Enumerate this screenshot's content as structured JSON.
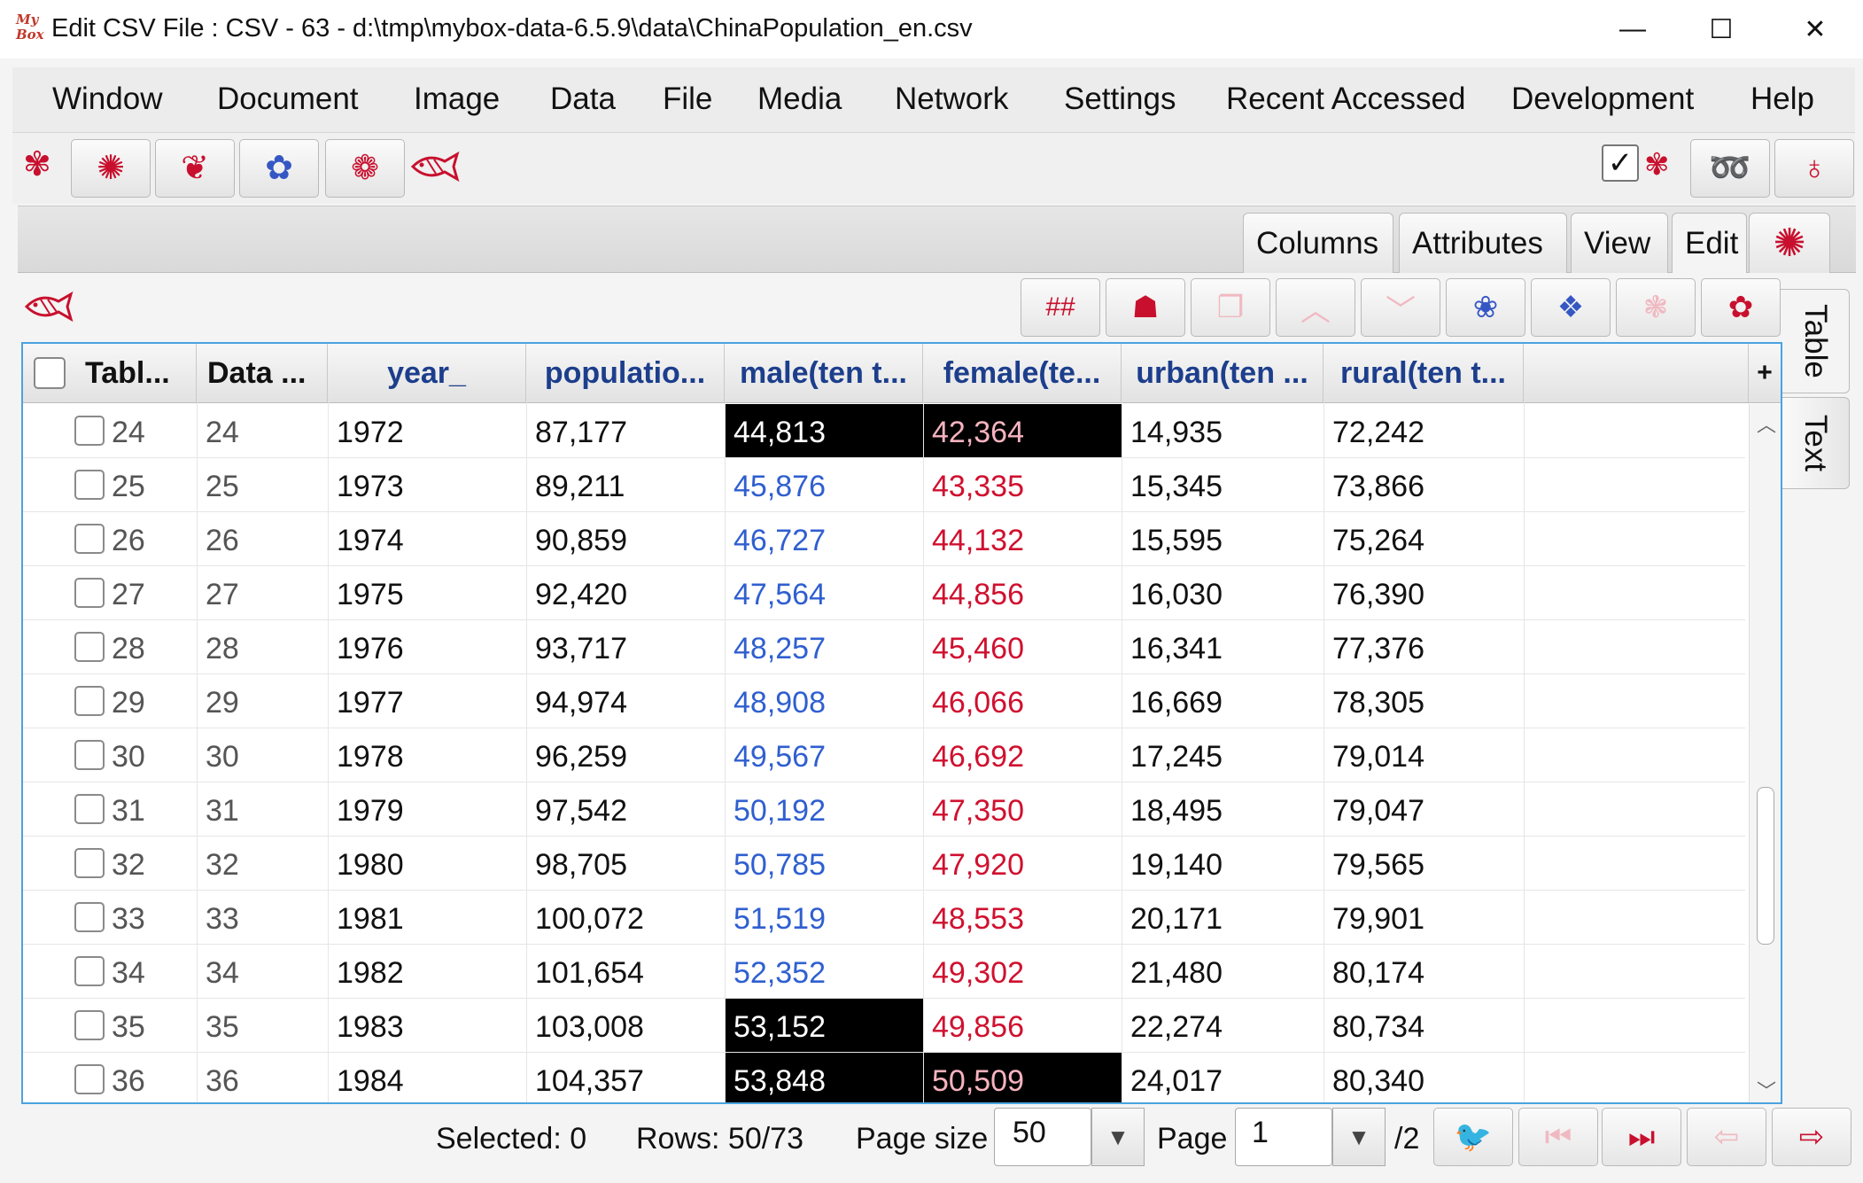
{
  "window": {
    "logo_text": "My Box",
    "title": "Edit CSV File : CSV - 63 - d:\\tmp\\mybox-data-6.5.9\\data\\ChinaPopulation_en.csv",
    "minimize": "—",
    "maximize": "☐",
    "close": "✕"
  },
  "menu": [
    "Window",
    "Document",
    "Image",
    "Data",
    "File",
    "Media",
    "Network",
    "Settings",
    "Recent Accessed",
    "Development",
    "Help"
  ],
  "toolbar": {
    "icons": [
      "rooster-icon",
      "swirl-icon",
      "lotus-icon",
      "flower-icon",
      "peony-icon",
      "fish-icon"
    ],
    "glyphs": [
      "✾",
      "✺",
      "❦",
      "✿",
      "❁",
      "✺"
    ],
    "checkbox_checked": true,
    "right_icons": [
      "rooster-icon",
      "cloud-swirl-icon",
      "gourd-icon"
    ]
  },
  "tabs": [
    "Columns",
    "Attributes",
    "View",
    "Edit"
  ],
  "side_tabs": [
    "Table",
    "Text"
  ],
  "edit_toolbar": {
    "hash_label": "##"
  },
  "table": {
    "columns": [
      "Tabl...",
      "Data ...",
      "year_",
      "populatio...",
      "male(ten t...",
      "female(te...",
      "urban(ten ...",
      "rural(ten t..."
    ],
    "add_column": "+",
    "rows": [
      {
        "t": "24",
        "d": "24",
        "year": "1972",
        "pop": "87,177",
        "male": "44,813",
        "female": "42,364",
        "urban": "14,935",
        "rural": "72,242",
        "male_sel": true,
        "female_sel": true
      },
      {
        "t": "25",
        "d": "25",
        "year": "1973",
        "pop": "89,211",
        "male": "45,876",
        "female": "43,335",
        "urban": "15,345",
        "rural": "73,866"
      },
      {
        "t": "26",
        "d": "26",
        "year": "1974",
        "pop": "90,859",
        "male": "46,727",
        "female": "44,132",
        "urban": "15,595",
        "rural": "75,264"
      },
      {
        "t": "27",
        "d": "27",
        "year": "1975",
        "pop": "92,420",
        "male": "47,564",
        "female": "44,856",
        "urban": "16,030",
        "rural": "76,390"
      },
      {
        "t": "28",
        "d": "28",
        "year": "1976",
        "pop": "93,717",
        "male": "48,257",
        "female": "45,460",
        "urban": "16,341",
        "rural": "77,376"
      },
      {
        "t": "29",
        "d": "29",
        "year": "1977",
        "pop": "94,974",
        "male": "48,908",
        "female": "46,066",
        "urban": "16,669",
        "rural": "78,305"
      },
      {
        "t": "30",
        "d": "30",
        "year": "1978",
        "pop": "96,259",
        "male": "49,567",
        "female": "46,692",
        "urban": "17,245",
        "rural": "79,014"
      },
      {
        "t": "31",
        "d": "31",
        "year": "1979",
        "pop": "97,542",
        "male": "50,192",
        "female": "47,350",
        "urban": "18,495",
        "rural": "79,047"
      },
      {
        "t": "32",
        "d": "32",
        "year": "1980",
        "pop": "98,705",
        "male": "50,785",
        "female": "47,920",
        "urban": "19,140",
        "rural": "79,565"
      },
      {
        "t": "33",
        "d": "33",
        "year": "1981",
        "pop": "100,072",
        "male": "51,519",
        "female": "48,553",
        "urban": "20,171",
        "rural": "79,901"
      },
      {
        "t": "34",
        "d": "34",
        "year": "1982",
        "pop": "101,654",
        "male": "52,352",
        "female": "49,302",
        "urban": "21,480",
        "rural": "80,174"
      },
      {
        "t": "35",
        "d": "35",
        "year": "1983",
        "pop": "103,008",
        "male": "53,152",
        "female": "49,856",
        "urban": "22,274",
        "rural": "80,734",
        "male_sel": true
      },
      {
        "t": "36",
        "d": "36",
        "year": "1984",
        "pop": "104,357",
        "male": "53,848",
        "female": "50,509",
        "urban": "24,017",
        "rural": "80,340",
        "male_sel": true,
        "female_sel": true
      }
    ]
  },
  "status": {
    "selected": "Selected: 0",
    "rows": "Rows: 50/73",
    "page_size_label": "Page size",
    "page_size": "50",
    "page_label": "Page",
    "page": "1",
    "page_total": "/2"
  },
  "colors": {
    "male": "#2f5fd0",
    "female": "#d0102f",
    "selection": "#000000",
    "accent": "#c8102e",
    "focus_border": "#4aa3e0"
  }
}
